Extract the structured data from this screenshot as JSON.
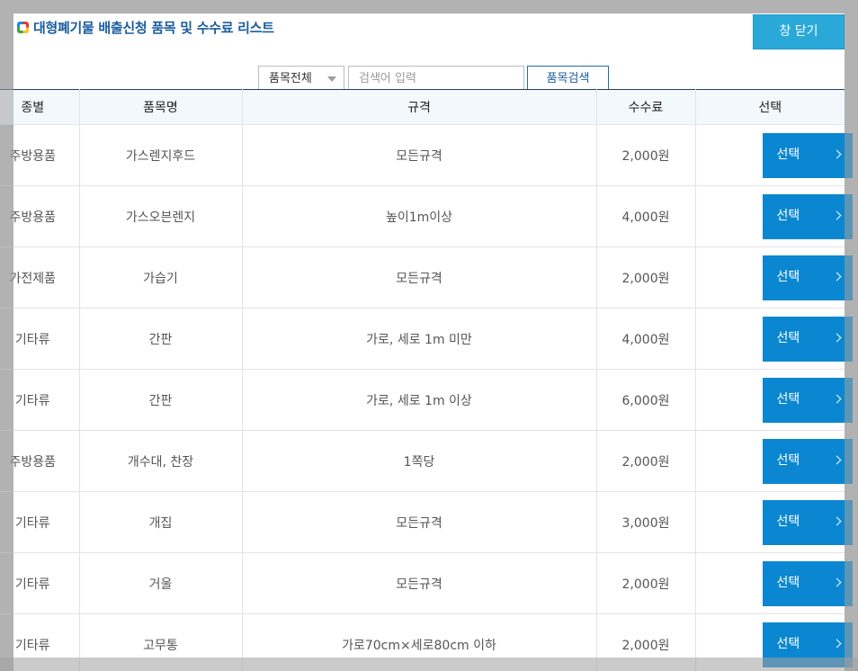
{
  "title": "대형폐기물 배출신청 품목 및 수수료 리스트",
  "close_label": "창 닫기",
  "search": {
    "category_selected": "품목전체",
    "placeholder": "검색어 입력",
    "button_label": "품목검색"
  },
  "table": {
    "headers": [
      "종별",
      "품목명",
      "규격",
      "수수료",
      "선택"
    ],
    "rows": [
      {
        "type": "주방용품",
        "name": "가스렌지후드",
        "spec": "모든규격",
        "fee": "2,000원",
        "action": "선택"
      },
      {
        "type": "주방용품",
        "name": "가스오븐렌지",
        "spec": "높이1m이상",
        "fee": "4,000원",
        "action": "선택"
      },
      {
        "type": "가전제품",
        "name": "가습기",
        "spec": "모든규격",
        "fee": "2,000원",
        "action": "선택"
      },
      {
        "type": "기타류",
        "name": "간판",
        "spec": "가로, 세로 1m 미만",
        "fee": "4,000원",
        "action": "선택"
      },
      {
        "type": "기타류",
        "name": "간판",
        "spec": "가로, 세로 1m 이상",
        "fee": "6,000원",
        "action": "선택"
      },
      {
        "type": "주방용품",
        "name": "개수대, 찬장",
        "spec": "1쪽당",
        "fee": "2,000원",
        "action": "선택"
      },
      {
        "type": "기타류",
        "name": "개집",
        "spec": "모든규격",
        "fee": "3,000원",
        "action": "선택"
      },
      {
        "type": "기타류",
        "name": "거울",
        "spec": "모든규격",
        "fee": "2,000원",
        "action": "선택"
      },
      {
        "type": "기타류",
        "name": "고무통",
        "spec": "가로70cm×세로80cm 이하",
        "fee": "2,000원",
        "action": "선택"
      }
    ]
  },
  "colors": {
    "title": "#1a5c9e",
    "close_button": "#2aa9d8",
    "select_button": "#0a87d0",
    "header_bg": "#f3f8fc"
  },
  "icons": {
    "title_logo": "app-logo-icon",
    "select_dropdown": "chevron-down-icon",
    "row_button": "chevron-right-icon"
  }
}
